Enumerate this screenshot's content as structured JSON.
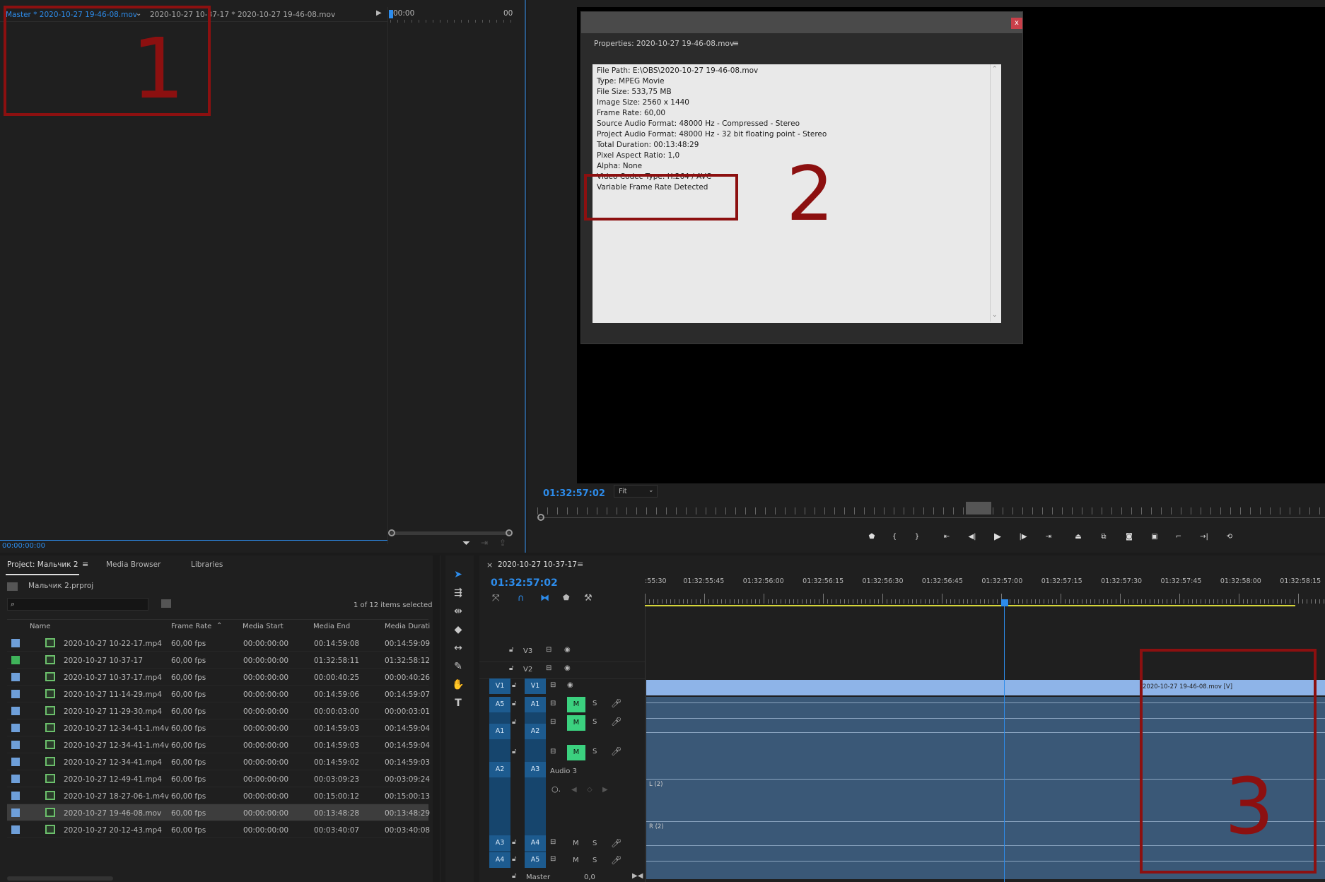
{
  "source_monitor": {
    "tab_label": "Master * 2020-10-27 19-46-08.mov",
    "tab2_label": "2020-10-27 10-37-17 * 2020-10-27 19-46-08.mov",
    "time_start": "00:00",
    "time_end": "00",
    "timecode": "00:00:00:00",
    "annotation": "1"
  },
  "properties_dialog": {
    "title": "Properties: 2020-10-27 19-46-08.mov",
    "close": "x",
    "lines": [
      "File Path: E:\\OBS\\2020-10-27 19-46-08.mov",
      "Type: MPEG Movie",
      "File Size: 533,75 MB",
      "Image Size: 2560 x 1440",
      "Frame Rate: 60,00",
      "Source Audio Format: 48000 Hz - Compressed - Stereo",
      "Project Audio Format: 48000 Hz - 32 bit floating point - Stereo",
      "Total Duration: 00:13:48:29",
      "Pixel Aspect Ratio: 1,0",
      "Alpha: None",
      "Video Codec Type: H.264 / AVC",
      "Variable Frame Rate Detected"
    ],
    "annotation": "2"
  },
  "program_monitor": {
    "timecode": "01:32:57:02",
    "fit": "Fit"
  },
  "project_panel": {
    "tabs": [
      "Project: Мальчик 2",
      "Media Browser",
      "Libraries"
    ],
    "project_file": "Мальчик 2.prproj",
    "selection_info": "1 of 12 items selected",
    "columns": [
      "Name",
      "Frame Rate",
      "Media Start",
      "Media End",
      "Media Durati"
    ],
    "rows": [
      {
        "name": "2020-10-27 10-22-17.mp4",
        "fps": "60,00 fps",
        "start": "00:00:00:00",
        "end": "00:14:59:08",
        "dur": "00:14:59:09",
        "color": "#6e9fd9",
        "type": "clip"
      },
      {
        "name": "2020-10-27 10-37-17",
        "fps": "60,00 fps",
        "start": "00:00:00:00",
        "end": "01:32:58:11",
        "dur": "01:32:58:12",
        "color": "#3fb35a",
        "type": "seq"
      },
      {
        "name": "2020-10-27 10-37-17.mp4",
        "fps": "60,00 fps",
        "start": "00:00:00:00",
        "end": "00:00:40:25",
        "dur": "00:00:40:26",
        "color": "#6e9fd9",
        "type": "clip"
      },
      {
        "name": "2020-10-27 11-14-29.mp4",
        "fps": "60,00 fps",
        "start": "00:00:00:00",
        "end": "00:14:59:06",
        "dur": "00:14:59:07",
        "color": "#6e9fd9",
        "type": "clip"
      },
      {
        "name": "2020-10-27 11-29-30.mp4",
        "fps": "60,00 fps",
        "start": "00:00:00:00",
        "end": "00:00:03:00",
        "dur": "00:00:03:01",
        "color": "#6e9fd9",
        "type": "clip"
      },
      {
        "name": "2020-10-27 12-34-41-1.m4v",
        "fps": "60,00 fps",
        "start": "00:00:00:00",
        "end": "00:14:59:03",
        "dur": "00:14:59:04",
        "color": "#6e9fd9",
        "type": "clip"
      },
      {
        "name": "2020-10-27 12-34-41-1.m4v",
        "fps": "60,00 fps",
        "start": "00:00:00:00",
        "end": "00:14:59:03",
        "dur": "00:14:59:04",
        "color": "#6e9fd9",
        "type": "clip"
      },
      {
        "name": "2020-10-27 12-34-41.mp4",
        "fps": "60,00 fps",
        "start": "00:00:00:00",
        "end": "00:14:59:02",
        "dur": "00:14:59:03",
        "color": "#6e9fd9",
        "type": "clip"
      },
      {
        "name": "2020-10-27 12-49-41.mp4",
        "fps": "60,00 fps",
        "start": "00:00:00:00",
        "end": "00:03:09:23",
        "dur": "00:03:09:24",
        "color": "#6e9fd9",
        "type": "clip"
      },
      {
        "name": "2020-10-27 18-27-06-1.m4v",
        "fps": "60,00 fps",
        "start": "00:00:00:00",
        "end": "00:15:00:12",
        "dur": "00:15:00:13",
        "color": "#6e9fd9",
        "type": "clip"
      },
      {
        "name": "2020-10-27 19-46-08.mov",
        "fps": "60,00 fps",
        "start": "00:00:00:00",
        "end": "00:13:48:28",
        "dur": "00:13:48:29",
        "color": "#6e9fd9",
        "type": "clip",
        "selected": true
      },
      {
        "name": "2020-10-27 20-12-43.mp4",
        "fps": "60,00 fps",
        "start": "00:00:00:00",
        "end": "00:03:40:07",
        "dur": "00:03:40:08",
        "color": "#6e9fd9",
        "type": "clip"
      }
    ]
  },
  "timeline": {
    "sequence_tab": "2020-10-27 10-37-17",
    "close": "×",
    "timecode": "01:32:57:02",
    "ruler_labels": [
      ":55:30",
      "01:32:55:45",
      "01:32:56:00",
      "01:32:56:15",
      "01:32:56:30",
      "01:32:56:45",
      "01:32:57:00",
      "01:32:57:15",
      "01:32:57:30",
      "01:32:57:45",
      "01:32:58:00",
      "01:32:58:15"
    ],
    "video_tracks": [
      "V3",
      "V2",
      "V1"
    ],
    "source_video": "V1",
    "audio_tracks": [
      "A1",
      "A2",
      "A3",
      "A4",
      "A5"
    ],
    "source_audio": [
      "A5",
      "A1",
      "A2",
      "A3",
      "A4"
    ],
    "audio3_label": "Audio 3",
    "m": "M",
    "s": "S",
    "master_label": "Master",
    "master_value": "0,0",
    "clip_label": "2020-10-27 19-46-08.mov [V]",
    "channel_l": "L (2)",
    "channel_r": "R (2)",
    "annotation": "3"
  }
}
